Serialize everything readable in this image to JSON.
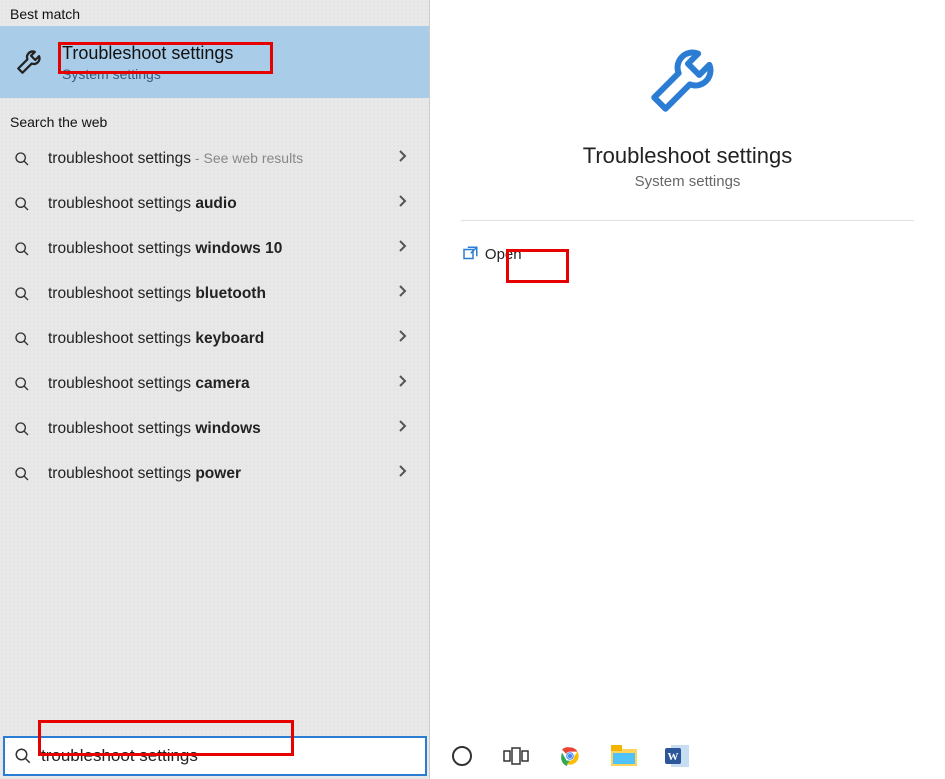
{
  "left": {
    "best_match_header": "Best match",
    "best_match": {
      "title": "Troubleshoot settings",
      "subtitle": "System settings"
    },
    "web_header": "Search the web",
    "web_items": [
      {
        "prefix": "troubleshoot settings",
        "bold": "",
        "hint": " - See web results"
      },
      {
        "prefix": "troubleshoot settings ",
        "bold": "audio",
        "hint": ""
      },
      {
        "prefix": "troubleshoot settings ",
        "bold": "windows 10",
        "hint": ""
      },
      {
        "prefix": "troubleshoot settings ",
        "bold": "bluetooth",
        "hint": ""
      },
      {
        "prefix": "troubleshoot settings ",
        "bold": "keyboard",
        "hint": ""
      },
      {
        "prefix": "troubleshoot settings ",
        "bold": "camera",
        "hint": ""
      },
      {
        "prefix": "troubleshoot settings ",
        "bold": "windows",
        "hint": ""
      },
      {
        "prefix": "troubleshoot settings ",
        "bold": "power",
        "hint": ""
      }
    ]
  },
  "right": {
    "title": "Troubleshoot settings",
    "subtitle": "System settings",
    "actions": {
      "open": "Open"
    }
  },
  "search": {
    "value": "troubleshoot settings"
  },
  "taskbar": {
    "icons": [
      "cortana-icon",
      "taskview-icon",
      "chrome-icon",
      "explorer-icon",
      "word-icon"
    ]
  },
  "colors": {
    "accent": "#2b7cd3",
    "highlight": "#a9cde9",
    "red": "#e60000"
  }
}
